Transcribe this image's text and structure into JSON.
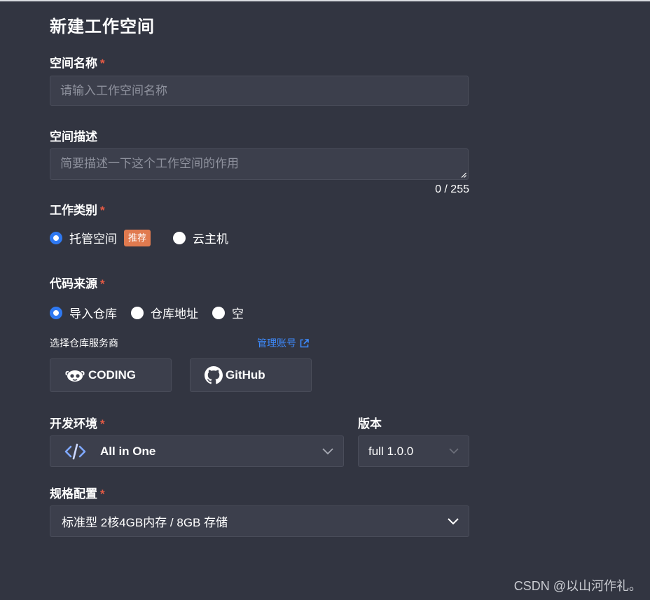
{
  "form": {
    "title": "新建工作空间",
    "name": {
      "label": "空间名称",
      "required": "*",
      "placeholder": "请输入工作空间名称",
      "value": ""
    },
    "desc": {
      "label": "空间描述",
      "placeholder": "简要描述一下这个工作空间的作用",
      "value": "",
      "counter": "0 / 255"
    },
    "workType": {
      "label": "工作类别",
      "required": "*",
      "options": [
        {
          "label": "托管空间",
          "badge": "推荐",
          "checked": true
        },
        {
          "label": "云主机",
          "checked": false
        }
      ]
    },
    "codeSource": {
      "label": "代码来源",
      "required": "*",
      "options": [
        {
          "label": "导入仓库",
          "checked": true
        },
        {
          "label": "仓库地址",
          "checked": false
        },
        {
          "label": "空",
          "checked": false
        }
      ],
      "provider_label": "选择仓库服务商",
      "manage_link": "管理账号",
      "providers": [
        {
          "label": "CODING",
          "icon": "coding-logo-icon"
        },
        {
          "label": "GitHub",
          "icon": "github-logo-icon"
        }
      ]
    },
    "devEnv": {
      "label": "开发环境",
      "required": "*",
      "value": "All in One",
      "icon": "code-icon"
    },
    "version": {
      "label": "版本",
      "value": "full 1.0.0"
    },
    "spec": {
      "label": "规格配置",
      "required": "*",
      "value": "标准型 2核4GB内存 / 8GB 存储"
    }
  },
  "watermark": "CSDN @以山河作礼。",
  "colors": {
    "background": "#323541",
    "input_bg": "#3c3f4c",
    "required": "#e55a44",
    "accent": "#2f79f2",
    "link": "#3d8bff",
    "badge": "#e07a4f"
  }
}
